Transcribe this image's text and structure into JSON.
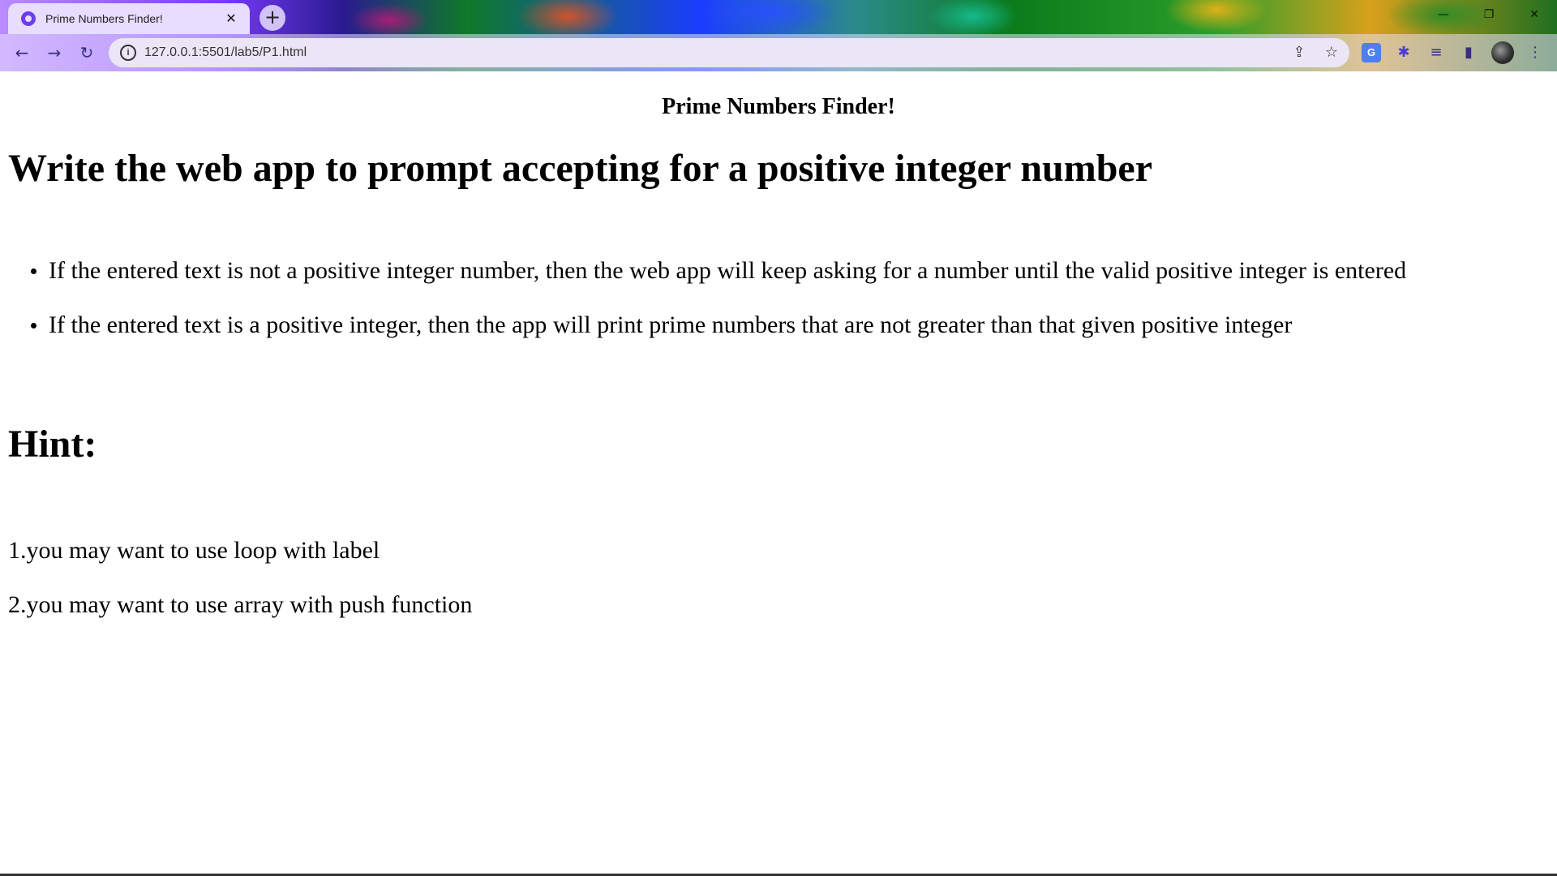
{
  "browser": {
    "tab": {
      "title": "Prime Numbers Finder!",
      "close_glyph": "✕",
      "favicon": "globe-icon"
    },
    "new_tab_glyph": "+",
    "window_controls": {
      "minimize": "—",
      "restore": "❐",
      "close": "✕"
    },
    "nav": {
      "back": "←",
      "forward": "→",
      "reload": "↻"
    },
    "omnibox": {
      "info_glyph": "i",
      "url": "127.0.0.1:5501/lab5/P1.html",
      "share_glyph": "⇪",
      "star_glyph": "☆"
    },
    "toolbar_icons": {
      "translate": "G",
      "extensions": "✱",
      "media": "≡",
      "sidepanel": "▮",
      "menu": "⋮"
    },
    "accent_color": "#6a3ef0"
  },
  "page": {
    "title": "Prime Numbers Finder!",
    "heading": "Write the web app to prompt accepting for a positive integer number",
    "bullets": [
      "If the entered text is not a positive integer number, then the web app will keep asking for a number until the valid positive integer is entered",
      "If the entered text is a positive integer, then the app will print prime numbers that are not greater than that given positive integer"
    ],
    "hint_heading": "Hint:",
    "hints": [
      "1.you may want to use loop with label",
      "2.you may want to use array with push function"
    ]
  }
}
